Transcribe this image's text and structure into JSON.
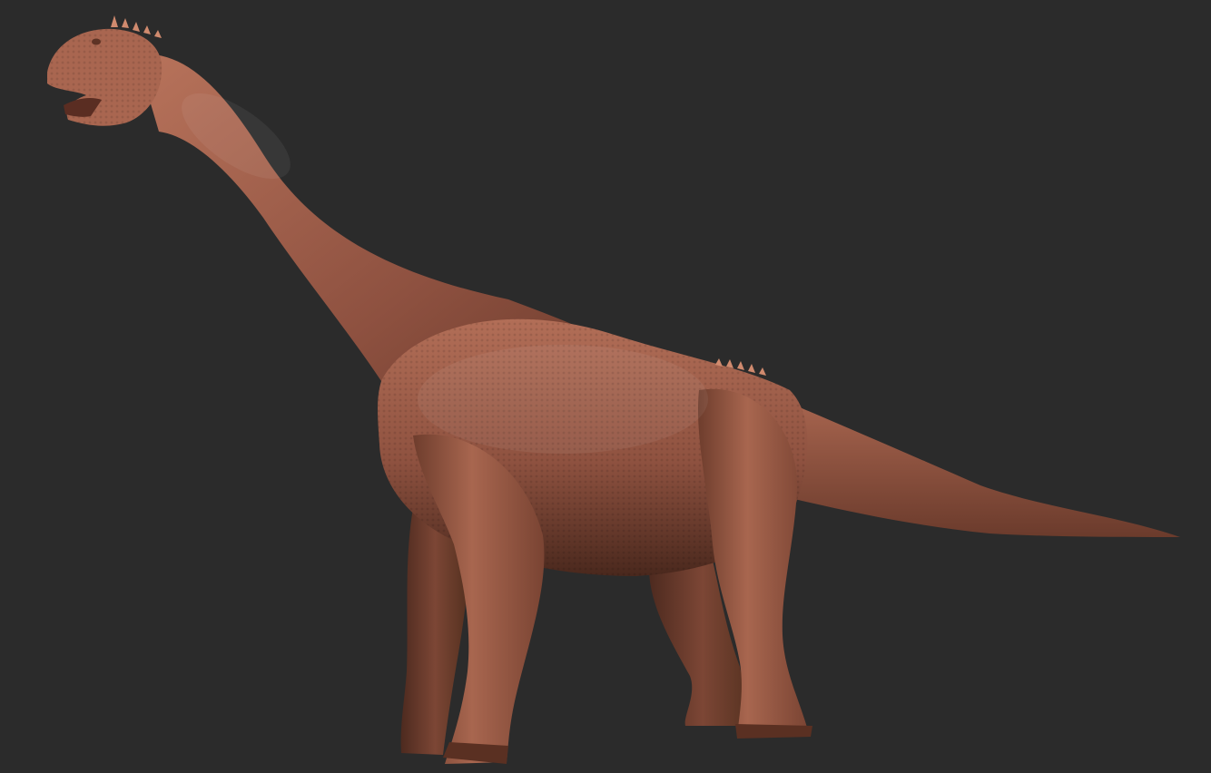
{
  "scene": {
    "subject": "sauropod-sculpt-render",
    "background_color": "#2b2b2b",
    "colors": {
      "skin_base": "#9a5a45",
      "skin_highlight": "#c98a72",
      "skin_shadow": "#5e3325",
      "skin_deep_shadow": "#3f2219",
      "spikes": "#d08a6e"
    }
  }
}
